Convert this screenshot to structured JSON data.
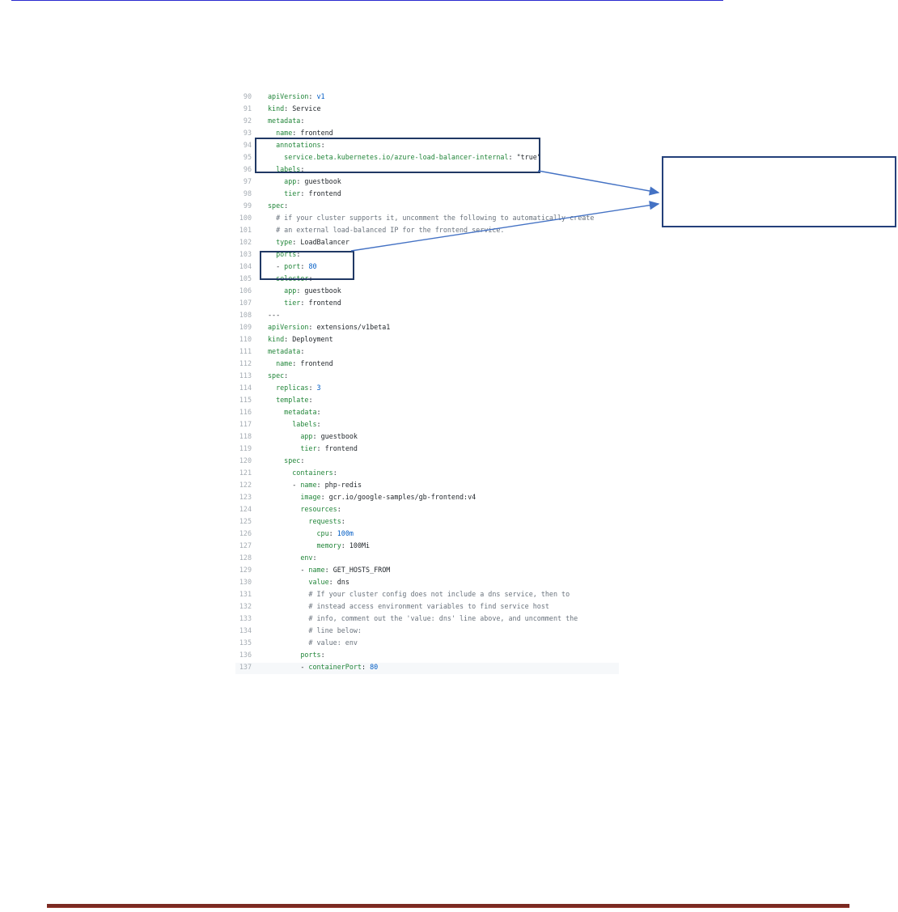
{
  "code_lines": [
    {
      "ln": "90",
      "segs": [
        [
          "k",
          "apiVersion"
        ],
        [
          "p",
          ": "
        ],
        [
          "n",
          "v1"
        ]
      ]
    },
    {
      "ln": "91",
      "segs": [
        [
          "k",
          "kind"
        ],
        [
          "p",
          ": "
        ],
        [
          "p",
          "Service"
        ]
      ]
    },
    {
      "ln": "92",
      "segs": [
        [
          "k",
          "metadata"
        ],
        [
          "p",
          ":"
        ]
      ]
    },
    {
      "ln": "93",
      "segs": [
        [
          "p",
          "  "
        ],
        [
          "k",
          "name"
        ],
        [
          "p",
          ": "
        ],
        [
          "p",
          "frontend"
        ]
      ]
    },
    {
      "ln": "94",
      "segs": [
        [
          "p",
          "  "
        ],
        [
          "k",
          "annotations"
        ],
        [
          "p",
          ":"
        ]
      ]
    },
    {
      "ln": "95",
      "segs": [
        [
          "p",
          "    "
        ],
        [
          "k",
          "service.beta.kubernetes.io/azure-load-balancer-internal"
        ],
        [
          "p",
          ": "
        ],
        [
          "s",
          "\"true\""
        ]
      ]
    },
    {
      "ln": "96",
      "segs": [
        [
          "p",
          "  "
        ],
        [
          "k",
          "labels"
        ],
        [
          "p",
          ":"
        ]
      ]
    },
    {
      "ln": "97",
      "segs": [
        [
          "p",
          "    "
        ],
        [
          "k",
          "app"
        ],
        [
          "p",
          ": "
        ],
        [
          "p",
          "guestbook"
        ]
      ]
    },
    {
      "ln": "98",
      "segs": [
        [
          "p",
          "    "
        ],
        [
          "k",
          "tier"
        ],
        [
          "p",
          ": "
        ],
        [
          "p",
          "frontend"
        ]
      ]
    },
    {
      "ln": "99",
      "segs": [
        [
          "k",
          "spec"
        ],
        [
          "p",
          ":"
        ]
      ]
    },
    {
      "ln": "100",
      "segs": [
        [
          "p",
          "  "
        ],
        [
          "c",
          "# if your cluster supports it, uncomment the following to automatically create"
        ]
      ]
    },
    {
      "ln": "101",
      "segs": [
        [
          "p",
          "  "
        ],
        [
          "c",
          "# an external load-balanced IP for the frontend service."
        ]
      ]
    },
    {
      "ln": "102",
      "segs": [
        [
          "p",
          "  "
        ],
        [
          "k",
          "type"
        ],
        [
          "p",
          ": "
        ],
        [
          "p",
          "LoadBalancer"
        ]
      ]
    },
    {
      "ln": "103",
      "segs": [
        [
          "p",
          "  "
        ],
        [
          "k",
          "ports"
        ],
        [
          "p",
          ":"
        ]
      ]
    },
    {
      "ln": "104",
      "segs": [
        [
          "p",
          "  - "
        ],
        [
          "k",
          "port"
        ],
        [
          "p",
          ": "
        ],
        [
          "n",
          "80"
        ]
      ]
    },
    {
      "ln": "105",
      "segs": [
        [
          "p",
          "  "
        ],
        [
          "k",
          "selector"
        ],
        [
          "p",
          ":"
        ]
      ]
    },
    {
      "ln": "106",
      "segs": [
        [
          "p",
          "    "
        ],
        [
          "k",
          "app"
        ],
        [
          "p",
          ": "
        ],
        [
          "p",
          "guestbook"
        ]
      ]
    },
    {
      "ln": "107",
      "segs": [
        [
          "p",
          "    "
        ],
        [
          "k",
          "tier"
        ],
        [
          "p",
          ": "
        ],
        [
          "p",
          "frontend"
        ]
      ]
    },
    {
      "ln": "108",
      "segs": [
        [
          "p",
          "---"
        ]
      ]
    },
    {
      "ln": "109",
      "segs": [
        [
          "k",
          "apiVersion"
        ],
        [
          "p",
          ": "
        ],
        [
          "p",
          "extensions/v1beta1"
        ]
      ]
    },
    {
      "ln": "110",
      "segs": [
        [
          "k",
          "kind"
        ],
        [
          "p",
          ": "
        ],
        [
          "p",
          "Deployment"
        ]
      ]
    },
    {
      "ln": "111",
      "segs": [
        [
          "k",
          "metadata"
        ],
        [
          "p",
          ":"
        ]
      ]
    },
    {
      "ln": "112",
      "segs": [
        [
          "p",
          "  "
        ],
        [
          "k",
          "name"
        ],
        [
          "p",
          ": "
        ],
        [
          "p",
          "frontend"
        ]
      ]
    },
    {
      "ln": "113",
      "segs": [
        [
          "k",
          "spec"
        ],
        [
          "p",
          ":"
        ]
      ]
    },
    {
      "ln": "114",
      "segs": [
        [
          "p",
          "  "
        ],
        [
          "k",
          "replicas"
        ],
        [
          "p",
          ": "
        ],
        [
          "n",
          "3"
        ]
      ]
    },
    {
      "ln": "115",
      "segs": [
        [
          "p",
          "  "
        ],
        [
          "k",
          "template"
        ],
        [
          "p",
          ":"
        ]
      ]
    },
    {
      "ln": "116",
      "segs": [
        [
          "p",
          "    "
        ],
        [
          "k",
          "metadata"
        ],
        [
          "p",
          ":"
        ]
      ]
    },
    {
      "ln": "117",
      "segs": [
        [
          "p",
          "      "
        ],
        [
          "k",
          "labels"
        ],
        [
          "p",
          ":"
        ]
      ]
    },
    {
      "ln": "118",
      "segs": [
        [
          "p",
          "        "
        ],
        [
          "k",
          "app"
        ],
        [
          "p",
          ": "
        ],
        [
          "p",
          "guestbook"
        ]
      ]
    },
    {
      "ln": "119",
      "segs": [
        [
          "p",
          "        "
        ],
        [
          "k",
          "tier"
        ],
        [
          "p",
          ": "
        ],
        [
          "p",
          "frontend"
        ]
      ]
    },
    {
      "ln": "120",
      "segs": [
        [
          "p",
          "    "
        ],
        [
          "k",
          "spec"
        ],
        [
          "p",
          ":"
        ]
      ]
    },
    {
      "ln": "121",
      "segs": [
        [
          "p",
          "      "
        ],
        [
          "k",
          "containers"
        ],
        [
          "p",
          ":"
        ]
      ]
    },
    {
      "ln": "122",
      "segs": [
        [
          "p",
          "      - "
        ],
        [
          "k",
          "name"
        ],
        [
          "p",
          ": "
        ],
        [
          "p",
          "php-redis"
        ]
      ]
    },
    {
      "ln": "123",
      "segs": [
        [
          "p",
          "        "
        ],
        [
          "k",
          "image"
        ],
        [
          "p",
          ": "
        ],
        [
          "p",
          "gcr.io/google-samples/gb-frontend:v4"
        ]
      ]
    },
    {
      "ln": "124",
      "segs": [
        [
          "p",
          "        "
        ],
        [
          "k",
          "resources"
        ],
        [
          "p",
          ":"
        ]
      ]
    },
    {
      "ln": "125",
      "segs": [
        [
          "p",
          "          "
        ],
        [
          "k",
          "requests"
        ],
        [
          "p",
          ":"
        ]
      ]
    },
    {
      "ln": "126",
      "segs": [
        [
          "p",
          "            "
        ],
        [
          "k",
          "cpu"
        ],
        [
          "p",
          ": "
        ],
        [
          "n",
          "100m"
        ]
      ]
    },
    {
      "ln": "127",
      "segs": [
        [
          "p",
          "            "
        ],
        [
          "k",
          "memory"
        ],
        [
          "p",
          ": "
        ],
        [
          "p",
          "100Mi"
        ]
      ]
    },
    {
      "ln": "128",
      "segs": [
        [
          "p",
          "        "
        ],
        [
          "k",
          "env"
        ],
        [
          "p",
          ":"
        ]
      ]
    },
    {
      "ln": "129",
      "segs": [
        [
          "p",
          "        - "
        ],
        [
          "k",
          "name"
        ],
        [
          "p",
          ": "
        ],
        [
          "p",
          "GET_HOSTS_FROM"
        ]
      ]
    },
    {
      "ln": "130",
      "segs": [
        [
          "p",
          "          "
        ],
        [
          "k",
          "value"
        ],
        [
          "p",
          ": "
        ],
        [
          "p",
          "dns"
        ]
      ]
    },
    {
      "ln": "131",
      "segs": [
        [
          "p",
          "          "
        ],
        [
          "c",
          "# If your cluster config does not include a dns service, then to"
        ]
      ]
    },
    {
      "ln": "132",
      "segs": [
        [
          "p",
          "          "
        ],
        [
          "c",
          "# instead access environment variables to find service host"
        ]
      ]
    },
    {
      "ln": "133",
      "segs": [
        [
          "p",
          "          "
        ],
        [
          "c",
          "# info, comment out the 'value: dns' line above, and uncomment the"
        ]
      ]
    },
    {
      "ln": "134",
      "segs": [
        [
          "p",
          "          "
        ],
        [
          "c",
          "# line below:"
        ]
      ]
    },
    {
      "ln": "135",
      "segs": [
        [
          "p",
          "          "
        ],
        [
          "c",
          "# value: env"
        ]
      ]
    },
    {
      "ln": "136",
      "segs": [
        [
          "p",
          "        "
        ],
        [
          "k",
          "ports"
        ],
        [
          "p",
          ":"
        ]
      ]
    },
    {
      "ln": "137",
      "segs": [
        [
          "p",
          "        - "
        ],
        [
          "k",
          "containerPort"
        ],
        [
          "p",
          ": "
        ],
        [
          "n",
          "80"
        ]
      ]
    }
  ],
  "colors": {
    "key": "#22863a",
    "plain": "#24292e",
    "number": "#005cc5",
    "comment": "#6a737d",
    "line_number": "#a5acb3",
    "highlight_border": "#203864",
    "footer_rule": "#7a2a22"
  }
}
